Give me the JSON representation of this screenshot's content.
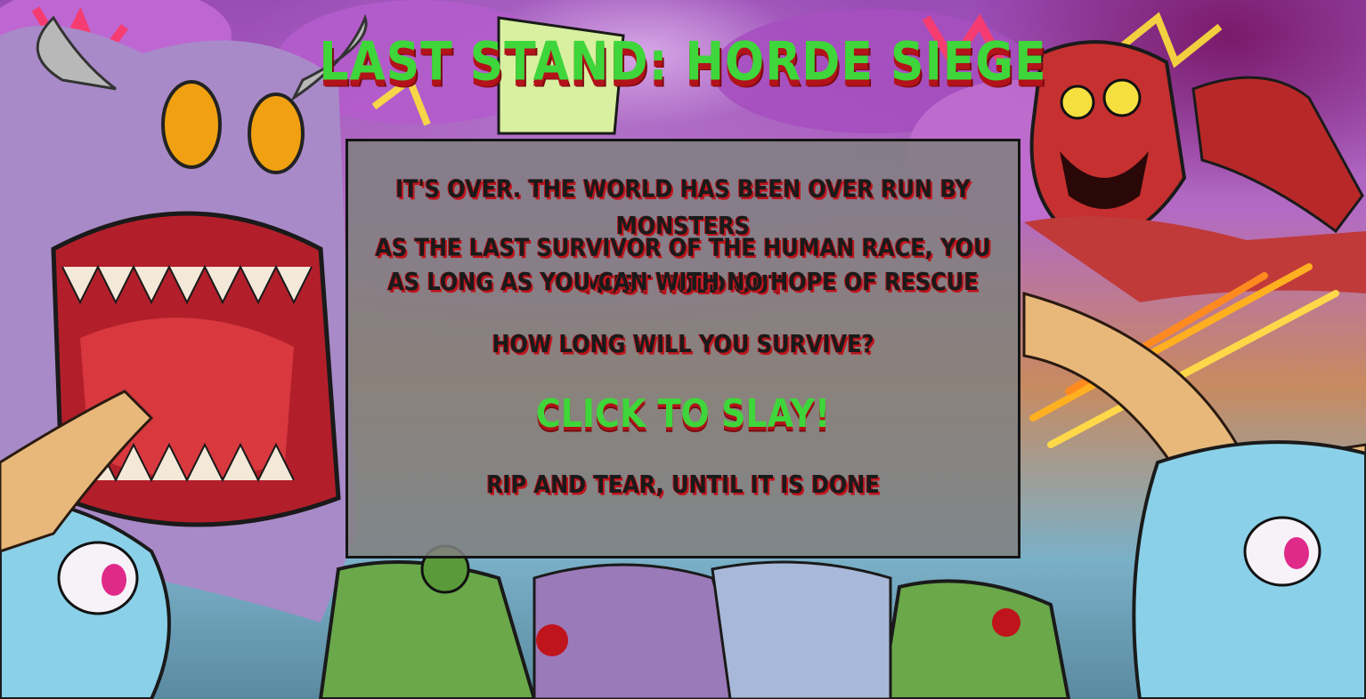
{
  "game": {
    "title": "LAST STAND: HORDE SIEGE"
  },
  "intro": {
    "line1": "IT'S OVER. THE WORLD HAS BEEN OVER RUN BY MONSTERS",
    "line2": "AS THE LAST SURVIVOR OF THE HUMAN RACE, YOU MUST HOLD OUT",
    "line3": "AS LONG AS YOU CAN WITH NO HOPE OF RESCUE",
    "line4": "HOW LONG WILL YOU SURVIVE?",
    "start_label": "CLICK TO SLAY!",
    "tagline": "RIP AND TEAR, UNTIL IT IS DONE"
  },
  "colors": {
    "title_green": "#3ed63a",
    "shadow_red": "#b3121a",
    "panel_gray": "#808080",
    "panel_border": "#141414"
  },
  "icons": {
    "background": "monster-horde-illustration"
  }
}
